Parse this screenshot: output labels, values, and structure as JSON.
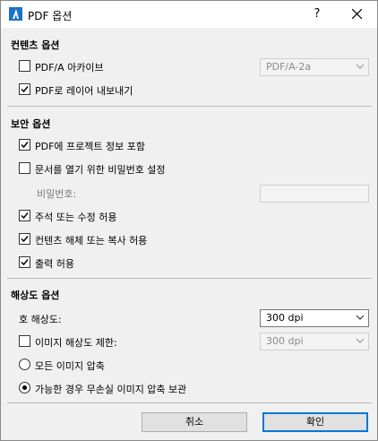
{
  "window": {
    "title": "PDF 옵션",
    "help": "?",
    "close": "✕"
  },
  "content_options": {
    "title": "컨텐츠 옵션",
    "pdfa_label": "PDF/A 아카이브",
    "pdfa_checked": false,
    "pdfa_version": "PDF/A-2a",
    "layers_label": "PDF로 레이어 내보내기",
    "layers_checked": true
  },
  "security_options": {
    "title": "보안 옵션",
    "project_info_label": "PDF에 프로젝트 정보 포함",
    "project_info_checked": true,
    "password_label": "문서를 열기 위한 비밀번호 설정",
    "password_checked": false,
    "password_field_label": "비밀번호:",
    "password_value": "",
    "annotate_label": "주석 또는 수정 허용",
    "annotate_checked": true,
    "extract_label": "컨텐츠 해체 또는 복사 허용",
    "extract_checked": true,
    "print_label": "출력 허용",
    "print_checked": true
  },
  "resolution_options": {
    "title": "해상도 옵션",
    "max_res_label": "호 해상도:",
    "max_res_value": "300 dpi",
    "limit_label": "이미지 해상도 제한:",
    "limit_checked": false,
    "limit_value": "300 dpi",
    "compress_all_label": "모든 이미지 압축",
    "compress_all_selected": false,
    "lossless_label": "가능한 경우 무손실 이미지 압축 보관",
    "lossless_selected": true
  },
  "buttons": {
    "cancel": "취소",
    "ok": "확인"
  }
}
